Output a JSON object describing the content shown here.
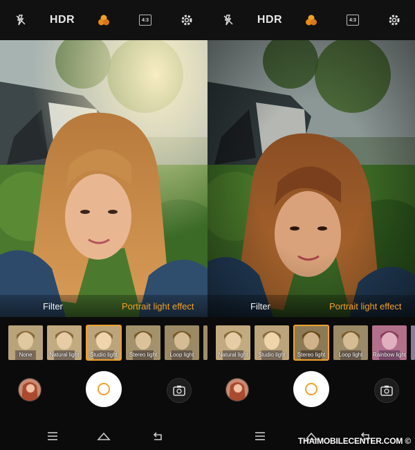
{
  "left": {
    "top_bar": {
      "hdr_label": "HDR",
      "ratio_label": "4:3"
    },
    "modes": {
      "filter": "Filter",
      "portrait": "Portrait light effect"
    },
    "thumbnails": [
      {
        "label": "None",
        "selected": false
      },
      {
        "label": "Natural light",
        "selected": false
      },
      {
        "label": "Studio light",
        "selected": true
      },
      {
        "label": "Stereo light",
        "selected": false
      },
      {
        "label": "Loop light",
        "selected": false
      }
    ]
  },
  "right": {
    "top_bar": {
      "hdr_label": "HDR",
      "ratio_label": "4:3"
    },
    "modes": {
      "filter": "Filter",
      "portrait": "Portrait light effect"
    },
    "thumbnails": [
      {
        "label": "Natural light",
        "selected": false
      },
      {
        "label": "Studio light",
        "selected": false
      },
      {
        "label": "Stereo light",
        "selected": true
      },
      {
        "label": "Loop light",
        "selected": false
      },
      {
        "label": "Rainbow light",
        "selected": false
      }
    ]
  },
  "watermark": {
    "text": "THAIMOBILECENTER.COM"
  },
  "colors": {
    "accent": "#f0a12a",
    "background": "#000000"
  }
}
